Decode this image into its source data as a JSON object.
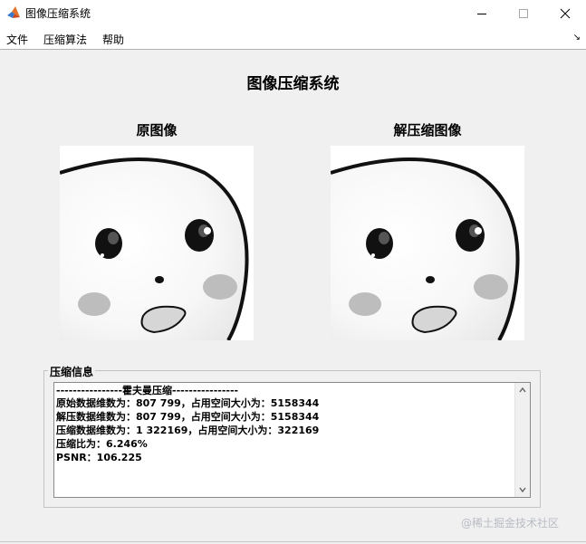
{
  "window": {
    "title": "图像压缩系统"
  },
  "menu": {
    "items": [
      "文件",
      "压缩算法",
      "帮助"
    ]
  },
  "main": {
    "title": "图像压缩系统",
    "original_title": "原图像",
    "decompressed_title": "解压缩图像"
  },
  "info_panel": {
    "title": "压缩信息",
    "lines": [
      "----------------霍夫曼压缩----------------",
      "原始数据维数为：807 799，占用空间大小为：5158344",
      "解压数据维数为：807 799，占用空间大小为：5158344",
      "压缩数据维数为：1 322169，占用空间大小为：322169",
      "压缩比为：6.246%",
      "PSNR：106.225"
    ]
  },
  "watermark": "@稀土掘金技术社区",
  "colors": {
    "titlebar": "#ffffff",
    "window_bg": "#f0f0f0",
    "cheek": "#bdbdbd"
  },
  "icons": {
    "app": "matlab-icon",
    "minimize": "minimize-icon",
    "maximize": "maximize-icon",
    "close": "close-icon"
  }
}
